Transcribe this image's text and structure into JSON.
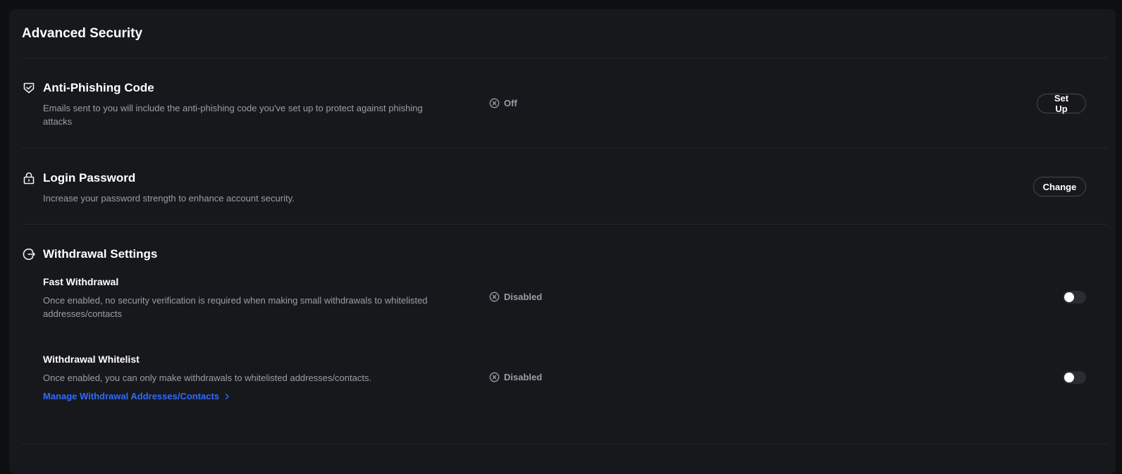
{
  "page": {
    "title": "Advanced Security"
  },
  "anti_phishing": {
    "icon": "shield-check-icon",
    "title": "Anti-Phishing Code",
    "description": "Emails sent to you will include the anti-phishing code you've set up to protect against phishing attacks",
    "status_icon": "circle-x-icon",
    "status": "Off",
    "button_label": "Set Up"
  },
  "login_password": {
    "icon": "lock-icon",
    "title": "Login Password",
    "description": "Increase your password strength to enhance account security.",
    "button_label": "Change"
  },
  "withdrawal_settings": {
    "icon": "logout-arrow-icon",
    "title": "Withdrawal Settings",
    "fast_withdrawal": {
      "title": "Fast Withdrawal",
      "description": "Once enabled, no security verification is required when making small withdrawals to whitelisted addresses/contacts",
      "status_icon": "circle-x-icon",
      "status": "Disabled",
      "enabled": false
    },
    "whitelist": {
      "title": "Withdrawal Whitelist",
      "description": "Once enabled, you can only make withdrawals to whitelisted addresses/contacts.",
      "status_icon": "circle-x-icon",
      "status": "Disabled",
      "enabled": false,
      "link_label": "Manage Withdrawal Addresses/Contacts",
      "link_icon": "chevron-right-icon"
    }
  },
  "colors": {
    "background": "#0e0f11",
    "card": "#17181c",
    "text_primary": "#ffffff",
    "text_secondary": "#9a9ea6",
    "link": "#2f6bff",
    "divider": "#24262b"
  }
}
